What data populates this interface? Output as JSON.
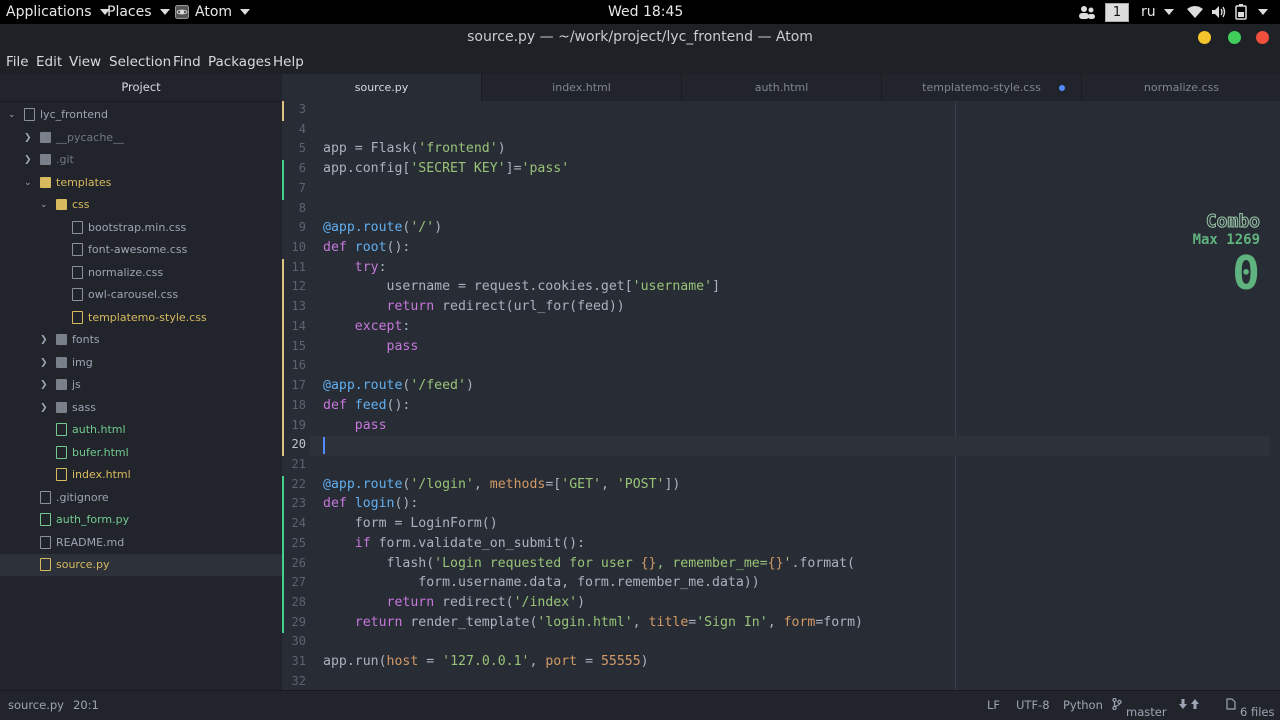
{
  "topbar": {
    "applications": "Applications",
    "places": "Places",
    "app": "Atom",
    "clock": "Wed 18:45",
    "workspace": "1",
    "lang": "ru"
  },
  "window": {
    "title": "source.py — ~/work/project/lyc_frontend — Atom"
  },
  "menu": [
    "File",
    "Edit",
    "View",
    "Selection",
    "Find",
    "Packages",
    "Help"
  ],
  "tree": {
    "header": "Project",
    "items": [
      {
        "label": "lyc_frontend",
        "type": "repo",
        "state": ""
      },
      {
        "label": "__pycache__",
        "type": "folder",
        "state": "dim"
      },
      {
        "label": ".git",
        "type": "folder",
        "state": "dim"
      },
      {
        "label": "templates",
        "type": "folder-open",
        "state": "mod"
      },
      {
        "label": "css",
        "type": "folder-open",
        "state": "mod"
      },
      {
        "label": "bootstrap.min.css",
        "type": "file",
        "state": ""
      },
      {
        "label": "font-awesome.css",
        "type": "file",
        "state": ""
      },
      {
        "label": "normalize.css",
        "type": "file",
        "state": ""
      },
      {
        "label": "owl-carousel.css",
        "type": "file",
        "state": ""
      },
      {
        "label": "templatemo-style.css",
        "type": "file",
        "state": "mod"
      },
      {
        "label": "fonts",
        "type": "folder",
        "state": ""
      },
      {
        "label": "img",
        "type": "folder",
        "state": ""
      },
      {
        "label": "js",
        "type": "folder",
        "state": ""
      },
      {
        "label": "sass",
        "type": "folder",
        "state": ""
      },
      {
        "label": "auth.html",
        "type": "file",
        "state": "new"
      },
      {
        "label": "bufer.html",
        "type": "file",
        "state": "new"
      },
      {
        "label": "index.html",
        "type": "file",
        "state": "mod"
      },
      {
        "label": ".gitignore",
        "type": "file",
        "state": ""
      },
      {
        "label": "auth_form.py",
        "type": "file",
        "state": "new"
      },
      {
        "label": "README.md",
        "type": "readme",
        "state": ""
      },
      {
        "label": "source.py",
        "type": "file",
        "state": "mod"
      }
    ]
  },
  "tabs": [
    {
      "label": "source.py",
      "active": true,
      "modified": false
    },
    {
      "label": "index.html",
      "active": false,
      "modified": false
    },
    {
      "label": "auth.html",
      "active": false,
      "modified": false
    },
    {
      "label": "templatemo-style.css",
      "active": false,
      "modified": true
    },
    {
      "label": "normalize.css",
      "active": false,
      "modified": false
    }
  ],
  "editor": {
    "current_line": 20,
    "lines": [
      {
        "n": 3,
        "t": "",
        "g": "mod"
      },
      {
        "n": 4,
        "t": "",
        "g": ""
      },
      {
        "n": 5,
        "t": "app = Flask('frontend')",
        "g": ""
      },
      {
        "n": 6,
        "t": "app.config['SECRET KEY']='pass'",
        "g": "add"
      },
      {
        "n": 7,
        "t": "",
        "g": "add"
      },
      {
        "n": 8,
        "t": "",
        "g": ""
      },
      {
        "n": 9,
        "t": "@app.route('/')",
        "g": ""
      },
      {
        "n": 10,
        "t": "def root():",
        "g": ""
      },
      {
        "n": 11,
        "t": "    try:",
        "g": "mod"
      },
      {
        "n": 12,
        "t": "        username = request.cookies.get['username']",
        "g": "mod"
      },
      {
        "n": 13,
        "t": "        return redirect(url_for(feed))",
        "g": "mod"
      },
      {
        "n": 14,
        "t": "    except:",
        "g": "mod"
      },
      {
        "n": 15,
        "t": "        pass",
        "g": "mod"
      },
      {
        "n": 16,
        "t": "",
        "g": "mod"
      },
      {
        "n": 17,
        "t": "@app.route('/feed')",
        "g": "mod"
      },
      {
        "n": 18,
        "t": "def feed():",
        "g": "mod"
      },
      {
        "n": 19,
        "t": "    pass",
        "g": "mod"
      },
      {
        "n": 20,
        "t": "",
        "g": "mod"
      },
      {
        "n": 21,
        "t": "",
        "g": ""
      },
      {
        "n": 22,
        "t": "@app.route('/login', methods=['GET', 'POST'])",
        "g": "add"
      },
      {
        "n": 23,
        "t": "def login():",
        "g": "add"
      },
      {
        "n": 24,
        "t": "    form = LoginForm()",
        "g": "add"
      },
      {
        "n": 25,
        "t": "    if form.validate_on_submit():",
        "g": "add"
      },
      {
        "n": 26,
        "t": "        flash('Login requested for user {}, remember_me={}'.format(",
        "g": "add"
      },
      {
        "n": 27,
        "t": "            form.username.data, form.remember_me.data))",
        "g": "add"
      },
      {
        "n": 28,
        "t": "        return redirect('/index')",
        "g": "add"
      },
      {
        "n": 29,
        "t": "    return render_template('login.html', title='Sign In', form=form)",
        "g": "add"
      },
      {
        "n": 30,
        "t": "",
        "g": ""
      },
      {
        "n": 31,
        "t": "app.run(host = '127.0.0.1', port = 55555)",
        "g": ""
      },
      {
        "n": 32,
        "t": "",
        "g": ""
      }
    ]
  },
  "combo": {
    "title": "Combo",
    "max": "Max 1269",
    "count": "0"
  },
  "status": {
    "file": "source.py",
    "cursor": "20:1",
    "line_ending": "LF",
    "encoding": "UTF-8",
    "grammar": "Python",
    "branch": "master",
    "files": "6 files"
  },
  "colors": {
    "keyword": "#c678dd",
    "function": "#61afef",
    "string": "#98c379",
    "number": "#d19a66",
    "added": "#43d08a",
    "modified": "#e0c285"
  }
}
